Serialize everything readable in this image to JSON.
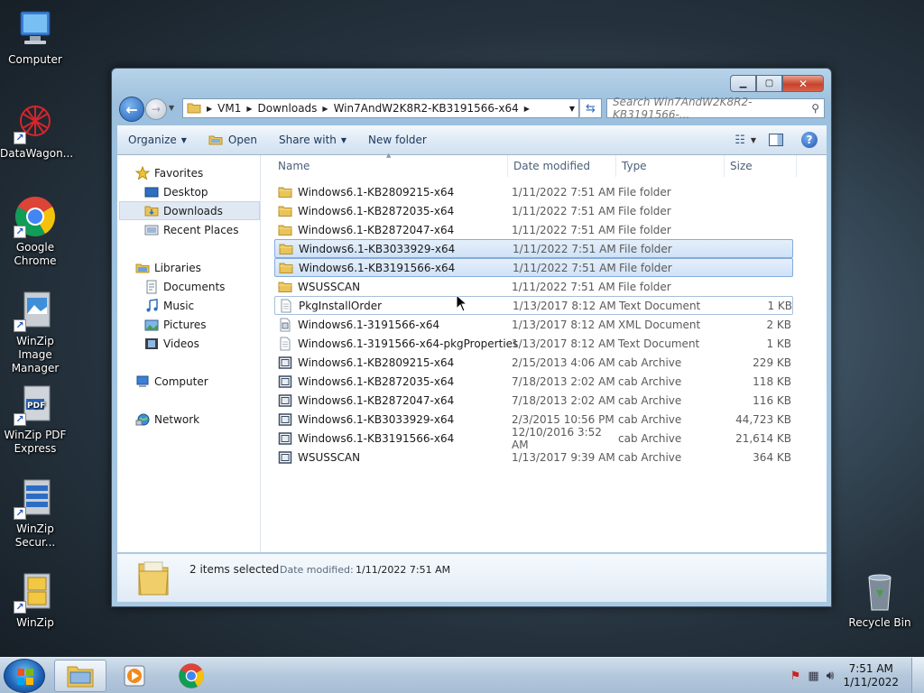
{
  "desktop": {
    "icons": [
      {
        "label": "Computer"
      },
      {
        "label": "DataWagon..."
      },
      {
        "label": "Google Chrome"
      },
      {
        "label": "WinZip Image Manager"
      },
      {
        "label": "WinZip PDF Express"
      },
      {
        "label": "WinZip Secur..."
      },
      {
        "label": "WinZip"
      },
      {
        "label": "Recycle Bin"
      }
    ]
  },
  "window": {
    "address": {
      "crumbs": [
        "VM1",
        "Downloads",
        "Win7AndW2K8R2-KB3191566-x64"
      ]
    },
    "search": {
      "placeholder": "Search Win7AndW2K8R2-KB3191566-..."
    },
    "toolbar": {
      "organize": "Organize",
      "open": "Open",
      "share_with": "Share with",
      "new_folder": "New folder"
    },
    "nav": {
      "favorites": "Favorites",
      "desktop": "Desktop",
      "downloads": "Downloads",
      "recent_places": "Recent Places",
      "libraries": "Libraries",
      "documents": "Documents",
      "music": "Music",
      "pictures": "Pictures",
      "videos": "Videos",
      "computer": "Computer",
      "network": "Network"
    },
    "columns": {
      "name": "Name",
      "date": "Date modified",
      "type": "Type",
      "size": "Size"
    },
    "files": [
      {
        "name": "Windows6.1-KB2809215-x64",
        "date": "1/11/2022 7:51 AM",
        "type": "File folder",
        "size": "",
        "icon": "folder-icon"
      },
      {
        "name": "Windows6.1-KB2872035-x64",
        "date": "1/11/2022 7:51 AM",
        "type": "File folder",
        "size": "",
        "icon": "folder-icon"
      },
      {
        "name": "Windows6.1-KB2872047-x64",
        "date": "1/11/2022 7:51 AM",
        "type": "File folder",
        "size": "",
        "icon": "folder-icon"
      },
      {
        "name": "Windows6.1-KB3033929-x64",
        "date": "1/11/2022 7:51 AM",
        "type": "File folder",
        "size": "",
        "icon": "folder-icon"
      },
      {
        "name": "Windows6.1-KB3191566-x64",
        "date": "1/11/2022 7:51 AM",
        "type": "File folder",
        "size": "",
        "icon": "folder-icon"
      },
      {
        "name": "WSUSSCAN",
        "date": "1/11/2022 7:51 AM",
        "type": "File folder",
        "size": "",
        "icon": "folder-icon"
      },
      {
        "name": "PkgInstallOrder",
        "date": "1/13/2017 8:12 AM",
        "type": "Text Document",
        "size": "1 KB",
        "icon": "text-document-icon"
      },
      {
        "name": "Windows6.1-3191566-x64",
        "date": "1/13/2017 8:12 AM",
        "type": "XML Document",
        "size": "2 KB",
        "icon": "xml-document-icon"
      },
      {
        "name": "Windows6.1-3191566-x64-pkgProperties",
        "date": "1/13/2017 8:12 AM",
        "type": "Text Document",
        "size": "1 KB",
        "icon": "text-document-icon"
      },
      {
        "name": "Windows6.1-KB2809215-x64",
        "date": "2/15/2013 4:06 AM",
        "type": "cab Archive",
        "size": "229 KB",
        "icon": "cab-archive-icon"
      },
      {
        "name": "Windows6.1-KB2872035-x64",
        "date": "7/18/2013 2:02 AM",
        "type": "cab Archive",
        "size": "118 KB",
        "icon": "cab-archive-icon"
      },
      {
        "name": "Windows6.1-KB2872047-x64",
        "date": "7/18/2013 2:02 AM",
        "type": "cab Archive",
        "size": "116 KB",
        "icon": "cab-archive-icon"
      },
      {
        "name": "Windows6.1-KB3033929-x64",
        "date": "2/3/2015 10:56 PM",
        "type": "cab Archive",
        "size": "44,723 KB",
        "icon": "cab-archive-icon"
      },
      {
        "name": "Windows6.1-KB3191566-x64",
        "date": "12/10/2016 3:52 AM",
        "type": "cab Archive",
        "size": "21,614 KB",
        "icon": "cab-archive-icon"
      },
      {
        "name": "WSUSSCAN",
        "date": "1/13/2017 9:39 AM",
        "type": "cab Archive",
        "size": "364 KB",
        "icon": "cab-archive-icon"
      }
    ],
    "selected_rows": [
      3,
      4
    ],
    "focused_row": 6,
    "details": {
      "count": "2 items selected",
      "date_label": "Date modified:",
      "date_value": "1/11/2022 7:51 AM"
    }
  },
  "taskbar": {
    "time": "7:51 AM",
    "date": "1/11/2022"
  },
  "colors": {
    "selection": "#cfe2f7",
    "selection_border": "#84acdd",
    "folder": "#e9c45a"
  }
}
